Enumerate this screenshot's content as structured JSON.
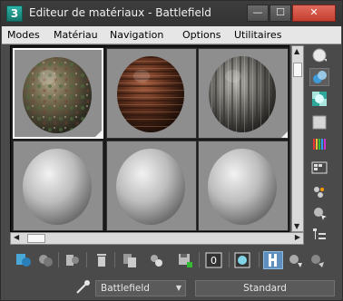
{
  "window": {
    "title": "Editeur de matériaux - Battlefield",
    "app_icon_label": "3",
    "minimize_glyph": "—",
    "maximize_glyph": "☐",
    "close_glyph": "✕"
  },
  "menu": {
    "items": [
      "Modes",
      "Matériau",
      "Navigation",
      "Options",
      "Utilitaires"
    ]
  },
  "sample_slots": [
    {
      "material": "mossy-rock",
      "selected": true
    },
    {
      "material": "wood-planks",
      "selected": false
    },
    {
      "material": "grey-wood",
      "selected": false
    },
    {
      "material": "default-grey",
      "selected": false
    },
    {
      "material": "default-grey",
      "selected": false
    },
    {
      "material": "default-grey",
      "selected": false
    }
  ],
  "side_toolbar": {
    "icons": [
      "sample-type-sphere-icon",
      "backlight-icon",
      "background-pattern-icon",
      "sample-uv-tiling-icon",
      "video-color-check-icon",
      "make-preview-icon",
      "options-icon",
      "select-by-material-icon",
      "material-map-navigator-icon"
    ]
  },
  "bottom_toolbar": {
    "icons": [
      "get-material-icon",
      "put-to-scene-icon",
      "assign-to-selection-icon",
      "reset-map-icon",
      "make-copy-icon",
      "make-unique-icon",
      "put-to-library-icon",
      "material-id-channel-icon",
      "show-shaded-in-viewport-icon",
      "show-end-result-icon",
      "go-to-parent-icon",
      "go-forward-to-sibling-icon"
    ],
    "material_id_value": "0"
  },
  "material_name": {
    "value": "Battlefield"
  },
  "material_type": {
    "label": "Standard"
  },
  "colors": {
    "title_bar": "#363636",
    "menu_bar": "#e6e6e6",
    "close_button": "#c94536",
    "panel": "#4a4a4a",
    "accent_active": "#5f8fbf"
  }
}
